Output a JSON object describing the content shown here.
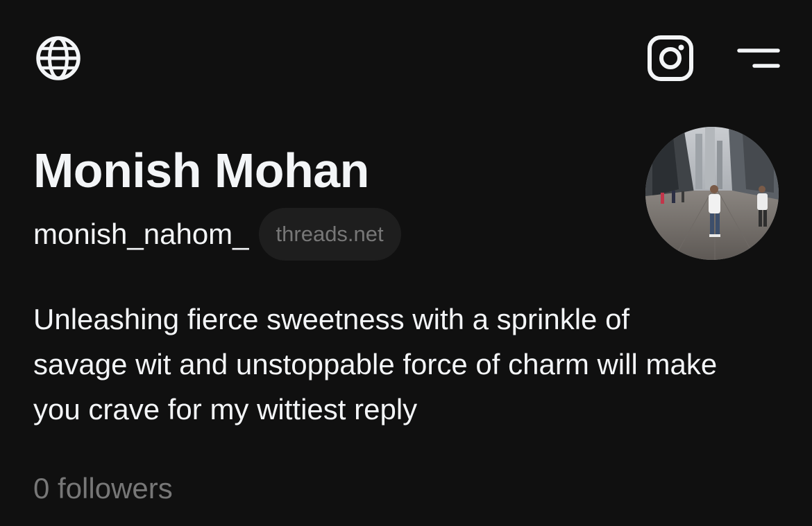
{
  "header": {
    "left_icon": "globe-icon",
    "right_icons": [
      "instagram-icon",
      "menu-icon"
    ]
  },
  "profile": {
    "name": "Monish Mohan",
    "username": "monish_nahom_",
    "domain_badge": "threads.net",
    "bio": "Unleashing fierce sweetness with a sprinkle of savage wit and unstoppable force of charm will make you crave for my wittiest reply",
    "followers": "0 followers",
    "avatar": "profile-photo"
  },
  "colors": {
    "background": "#101010",
    "text_primary": "#f3f5f7",
    "text_secondary": "#777777",
    "pill_background": "#1e1e1e"
  }
}
